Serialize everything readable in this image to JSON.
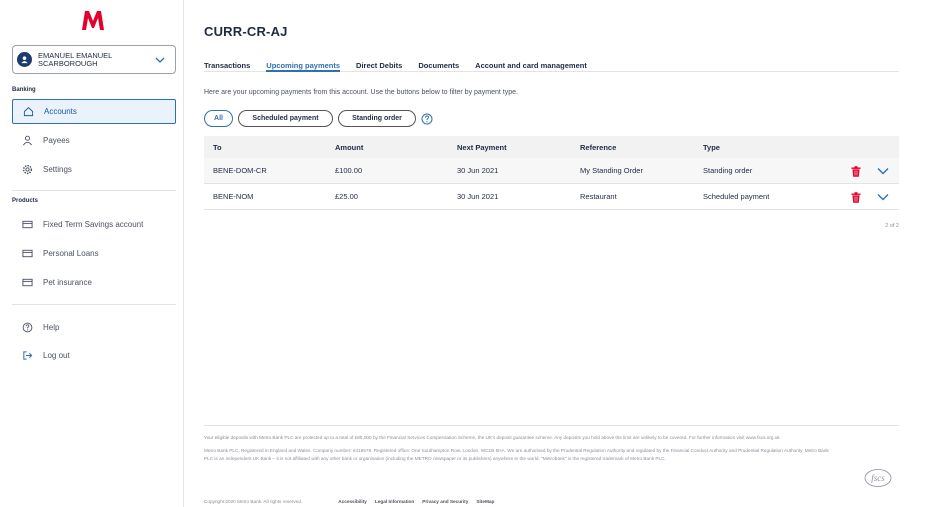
{
  "brand": {
    "logo_letter": "M",
    "logo_color": "#e4002b",
    "accent": "#2f6fb3"
  },
  "user": {
    "name": "EMANUEL EMANUEL SCARBOROUGH",
    "avatar_icon": "user-icon"
  },
  "sidebar": {
    "banking_label": "Banking",
    "banking_items": [
      {
        "label": "Accounts",
        "icon": "home-icon",
        "active": true
      },
      {
        "label": "Payees",
        "icon": "person-icon"
      },
      {
        "label": "Settings",
        "icon": "gear-icon"
      }
    ],
    "products_label": "Products",
    "product_items": [
      {
        "label": "Fixed Term Savings account",
        "icon": "card-icon"
      },
      {
        "label": "Personal Loans",
        "icon": "card-icon"
      },
      {
        "label": "Pet insurance",
        "icon": "card-icon"
      }
    ],
    "help_label": "Help",
    "logout_label": "Log out"
  },
  "account": {
    "title": "CURR-CR-AJ"
  },
  "tabs": [
    "Transactions",
    "Upcoming payments",
    "Direct Debits",
    "Documents",
    "Account and card management"
  ],
  "active_tab": 1,
  "intro_text": "Here are your upcoming payments from this account. Use the buttons below to filter by payment type.",
  "filters": [
    "All",
    "Scheduled payment",
    "Standing order"
  ],
  "table": {
    "headers": [
      "To",
      "Amount",
      "Next Payment",
      "Reference",
      "Type"
    ],
    "rows": [
      [
        "BENE-DOM-CR",
        "£100.00",
        "30 Jun 2021",
        "My Standing Order",
        "Standing order"
      ],
      [
        "BENE-NOM",
        "£25.00",
        "30 Jun 2021",
        "Restaurant",
        "Scheduled payment"
      ]
    ],
    "pager": "2 of 2"
  },
  "footer": {
    "p1": "Your eligible deposits with Metro Bank PLC are protected up to a total of £85,000 by the Financial Services Compensation Scheme, the UK's deposit guarantee scheme. Any deposits you hold above the limit are unlikely to be covered. For further information visit www.fscs.org.uk",
    "p2": "Metro Bank PLC. Registered in England and Wales. Company number: 6419578. Registered office: One Southampton Row, London, WC1B 5HA. We are authorised by the Prudential Regulation Authority and regulated by the Financial Conduct Authority and Prudential Regulation Authority. Metro Bank PLC is an independent UK Bank – it is not affiliated with any other bank or organisation (including the METRO newspaper or its publishers) anywhere in the world. \"Metrobank\" is the registered trademark of Metro Bank PLC.",
    "copyright": "Copyright 2020 Metro Bank. All rights reserved.",
    "links": [
      "Accessibility",
      "Legal Information",
      "Privacy and Security",
      "SiteMap"
    ],
    "fscs_logo": "fscs"
  }
}
